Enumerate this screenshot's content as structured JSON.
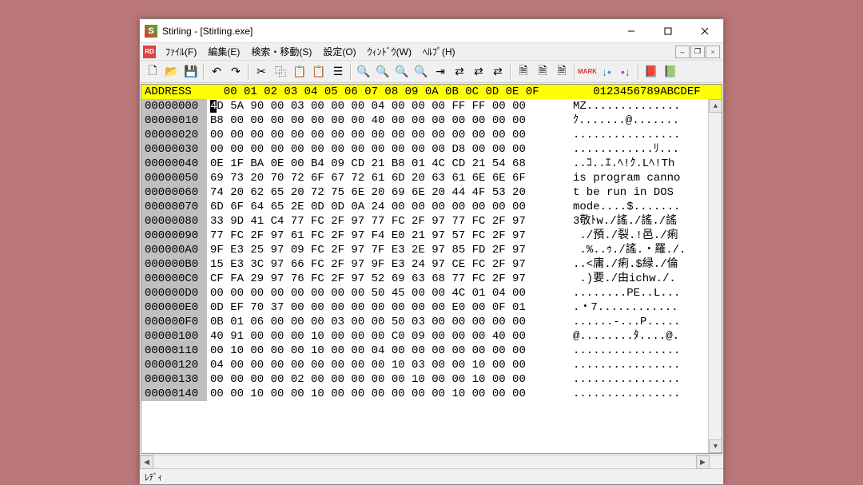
{
  "window": {
    "title": "Stirling - [Stirling.exe]"
  },
  "menus": {
    "file": "ﾌｧｲﾙ(F)",
    "edit": "編集(E)",
    "search": "検索・移動(S)",
    "settings": "設定(O)",
    "window": "ｳｨﾝﾄﾞｳ(W)",
    "help": "ﾍﾙﾌﾟ(H)"
  },
  "header": {
    "address": "ADDRESS",
    "bytes": "  00 01 02 03 04 05 06 07 08 09 0A 0B 0C 0D 0E 0F",
    "ascii": "   0123456789ABCDEF"
  },
  "rows": [
    {
      "addr": "00000000",
      "first": "4",
      "rest": "D 5A 90 00 03 00 00 00 04 00 00 00 FF FF 00 00",
      "ascii": "MZ.............."
    },
    {
      "addr": "00000010",
      "bytes": "B8 00 00 00 00 00 00 00 40 00 00 00 00 00 00 00",
      "ascii": "ｸ.......@......."
    },
    {
      "addr": "00000020",
      "bytes": "00 00 00 00 00 00 00 00 00 00 00 00 00 00 00 00",
      "ascii": "................"
    },
    {
      "addr": "00000030",
      "bytes": "00 00 00 00 00 00 00 00 00 00 00 00 D8 00 00 00",
      "ascii": "............ﾘ..."
    },
    {
      "addr": "00000040",
      "bytes": "0E 1F BA 0E 00 B4 09 CD 21 B8 01 4C CD 21 54 68",
      "ascii": "..ｺ..ｴ.ﾍ!ｸ.Lﾍ!Th"
    },
    {
      "addr": "00000050",
      "bytes": "69 73 20 70 72 6F 67 72 61 6D 20 63 61 6E 6E 6F",
      "ascii": "is program canno"
    },
    {
      "addr": "00000060",
      "bytes": "74 20 62 65 20 72 75 6E 20 69 6E 20 44 4F 53 20",
      "ascii": "t be run in DOS "
    },
    {
      "addr": "00000070",
      "bytes": "6D 6F 64 65 2E 0D 0D 0A 24 00 00 00 00 00 00 00",
      "ascii": "mode....$......."
    },
    {
      "addr": "00000080",
      "bytes": "33 9D 41 C4 77 FC 2F 97 77 FC 2F 97 77 FC 2F 97",
      "ascii": "3敬ﾄw./謠./謠./謠"
    },
    {
      "addr": "00000090",
      "bytes": "77 FC 2F 97 61 FC 2F 97 F4 E0 21 97 57 FC 2F 97",
      "ascii": " ./預./裂.!邑./痢"
    },
    {
      "addr": "000000A0",
      "bytes": "9F E3 25 97 09 FC 2F 97 7F E3 2E 97 85 FD 2F 97",
      "ascii": " .%..ｩ./謠.・羅./."
    },
    {
      "addr": "000000B0",
      "bytes": "15 E3 3C 97 66 FC 2F 97 9F E3 24 97 CE FC 2F 97",
      "ascii": "..<庸./痢.$緑./倫"
    },
    {
      "addr": "000000C0",
      "bytes": "CF FA 29 97 76 FC 2F 97 52 69 63 68 77 FC 2F 97",
      "ascii": " .)要./由ichw./."
    },
    {
      "addr": "000000D0",
      "bytes": "00 00 00 00 00 00 00 00 50 45 00 00 4C 01 04 00",
      "ascii": "........PE..L..."
    },
    {
      "addr": "000000E0",
      "bytes": "0D EF 70 37 00 00 00 00 00 00 00 00 E0 00 0F 01",
      "ascii": ".・7............"
    },
    {
      "addr": "000000F0",
      "bytes": "0B 01 06 00 00 00 03 00 00 50 03 00 00 00 00 00",
      "ascii": "......-...P....."
    },
    {
      "addr": "00000100",
      "bytes": "40 91 00 00 00 10 00 00 00 C0 09 00 00 00 40 00",
      "ascii": "@........ﾀ....@."
    },
    {
      "addr": "00000110",
      "bytes": "00 10 00 00 00 10 00 00 04 00 00 00 00 00 00 00",
      "ascii": "................"
    },
    {
      "addr": "00000120",
      "bytes": "04 00 00 00 00 00 00 00 00 10 03 00 00 10 00 00",
      "ascii": "................"
    },
    {
      "addr": "00000130",
      "bytes": "00 00 00 00 02 00 00 00 00 00 10 00 00 10 00 00",
      "ascii": "................"
    },
    {
      "addr": "00000140",
      "bytes": "00 00 10 00 00 10 00 00 00 00 00 00 10 00 00 00",
      "ascii": "................"
    }
  ],
  "status": "ﾚﾃﾞｨ",
  "toolbar_icons": [
    "new",
    "open",
    "save",
    "undo",
    "redo",
    "cut",
    "copy",
    "paste",
    "paste-insert",
    "select-all",
    "find",
    "find-next",
    "find-prev",
    "replace",
    "jump",
    "compare",
    "compare-next",
    "compare-prev",
    "copy-hex",
    "copy-text",
    "copy-addr",
    "mark",
    "mark-prev",
    "mark-next",
    "help",
    "about"
  ]
}
